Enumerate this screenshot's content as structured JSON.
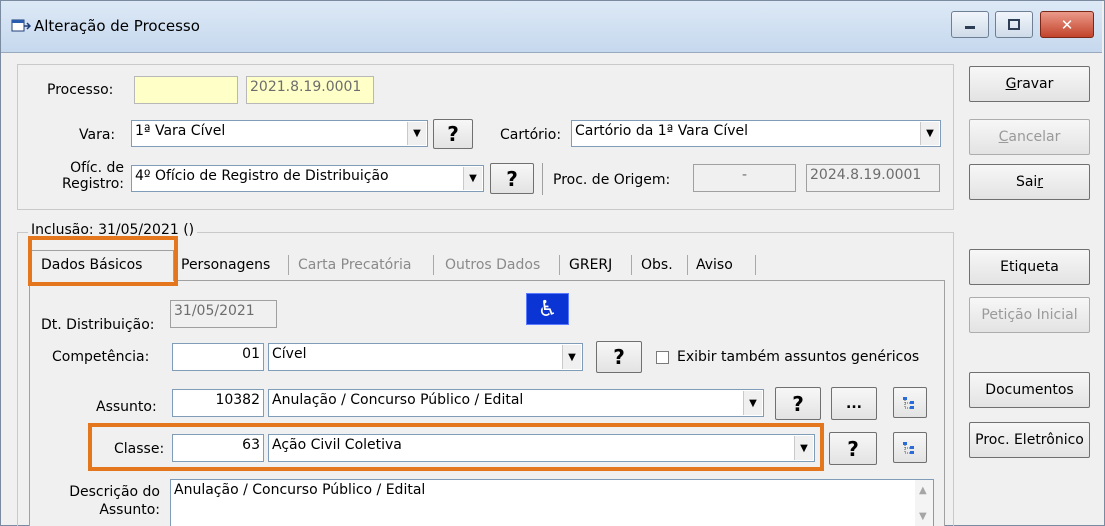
{
  "window": {
    "title": "Alteração de Processo",
    "colors": {
      "highlight": "#e4761e",
      "titlebar": "#c6d8ee",
      "accessibility": "#0a34d4"
    }
  },
  "header": {
    "processo_label": "Processo:",
    "processo_prefix": "",
    "processo_value": "2021.8.19.0001",
    "vara_label": "Vara:",
    "vara_value": "1ª Vara Cível",
    "cartorio_label": "Cartório:",
    "cartorio_value": "Cartório da 1ª Vara Cível",
    "ofic_label_line1": "Ofíc. de",
    "ofic_label_line2": "Registro:",
    "ofic_value": "4º Ofício de Registro de Distribuição",
    "proc_origem_label": "Proc. de Origem:",
    "proc_origem_sep": "-",
    "proc_origem_value": "2024.8.19.0001",
    "help_label": "?"
  },
  "side_buttons": [
    {
      "label": "Gravar",
      "mnemonic": "G",
      "rest": "ravar",
      "enabled": true
    },
    {
      "label": "Cancelar",
      "mnemonic": "C",
      "rest": "ancelar",
      "enabled": false
    },
    {
      "label": "Sair",
      "pre": "Sai",
      "mnemonic": "r",
      "enabled": true
    },
    {
      "label": "Etiqueta",
      "enabled": true
    },
    {
      "label": "Petição Inicial",
      "enabled": false
    },
    {
      "label": "Documentos",
      "enabled": true
    },
    {
      "label": "Proc. Eletrônico",
      "enabled": true
    }
  ],
  "group": {
    "caption": "Inclusão: 31/05/2021 ()"
  },
  "tabs": [
    {
      "label": "Dados Básicos",
      "active": true,
      "enabled": true
    },
    {
      "label": "Personagens",
      "active": false,
      "enabled": true
    },
    {
      "label": "Carta Precatória",
      "active": false,
      "enabled": false
    },
    {
      "label": "Outros Dados",
      "active": false,
      "enabled": false
    },
    {
      "label": "GRERJ",
      "active": false,
      "enabled": true
    },
    {
      "label": "Obs.",
      "active": false,
      "enabled": true
    },
    {
      "label": "Aviso",
      "active": false,
      "enabled": true
    }
  ],
  "form": {
    "dt_distribuicao_label": "Dt. Distribuição:",
    "dt_distribuicao_value": "31/05/2021",
    "accessibility_icon": "wheelchair-icon",
    "competencia_label": "Competência:",
    "competencia_code": "01",
    "competencia_value": "Cível",
    "exibir_label": "Exibir também assuntos genéricos",
    "exibir_checked": false,
    "assunto_label": "Assunto:",
    "assunto_code": "10382",
    "assunto_value": "Anulação / Concurso Público / Edital",
    "ellipsis_label": "...",
    "classe_label": "Classe:",
    "classe_code": "63",
    "classe_value": "Ação Civil Coletiva",
    "descricao_label_line1": "Descrição do",
    "descricao_label_line2": "Assunto:",
    "descricao_value": "Anulação / Concurso Público / Edital"
  }
}
